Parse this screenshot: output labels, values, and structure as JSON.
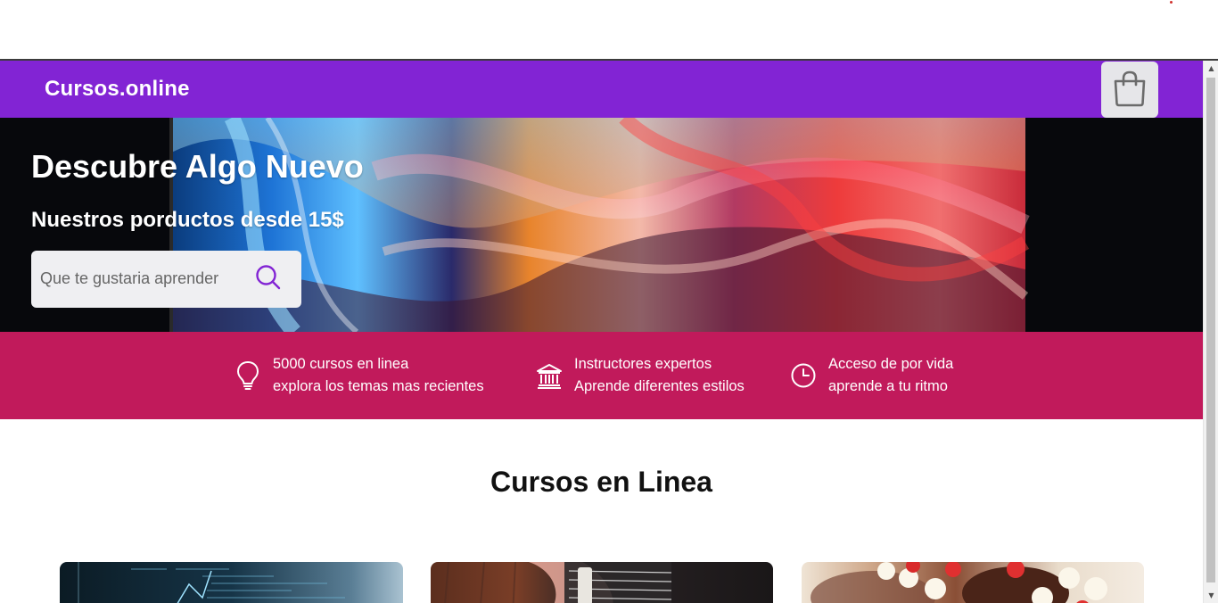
{
  "navbar": {
    "brand": "Cursos.online",
    "cart_icon": "shopping-bag-icon",
    "bg_color": "#8224d4"
  },
  "hero": {
    "title": "Descubre Algo Nuevo",
    "subtitle": "Nuestros porductos desde 15$",
    "search": {
      "placeholder": "Que te gustaria aprender",
      "value": "",
      "icon": "search-icon"
    }
  },
  "features": {
    "bg_color": "#c11a5b",
    "items": [
      {
        "icon": "lightbulb-icon",
        "line1": "5000 cursos en linea",
        "line2": "explora los temas mas recientes"
      },
      {
        "icon": "institution-icon",
        "line1": "Instructores expertos",
        "line2": "Aprende diferentes estilos"
      },
      {
        "icon": "clock-icon",
        "line1": "Acceso de por vida",
        "line2": "aprende a tu ritmo"
      }
    ]
  },
  "courses": {
    "section_title": "Cursos en Linea"
  }
}
